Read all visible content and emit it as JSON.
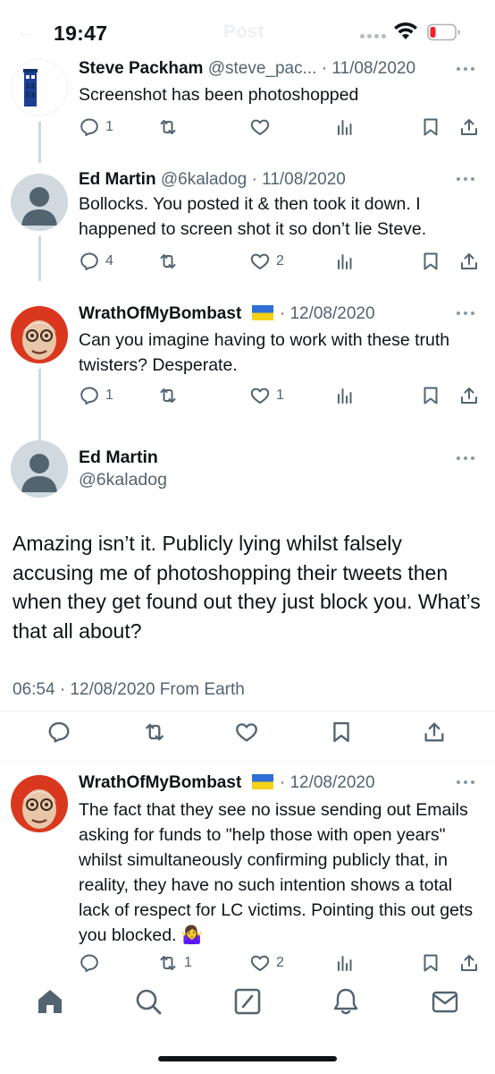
{
  "status_bar": {
    "time": "19:47",
    "ghost_title": "Post"
  },
  "tweets": [
    {
      "name": "Steve Packham",
      "handle": "@steve_pac...",
      "date": "11/08/2020",
      "text": "Screenshot has been photoshopped",
      "reply_count": "1",
      "retweet_count": "",
      "like_count": ""
    },
    {
      "name": "Ed Martin",
      "handle": "@6kaladog",
      "date": "11/08/2020",
      "text": "Bollocks. You posted it & then took it down. I happened to screen shot it so don’t lie Steve.",
      "reply_count": "4",
      "retweet_count": "",
      "like_count": "2"
    },
    {
      "name": "WrathOfMyBombast",
      "handle": "",
      "date": "12/08/2020",
      "text": "Can you imagine having to work with these truth twisters? Desperate.",
      "reply_count": "1",
      "retweet_count": "",
      "like_count": "1"
    }
  ],
  "main_tweet": {
    "name": "Ed Martin",
    "handle": "@6kaladog",
    "text": "Amazing isn’t it. Publicly lying whilst falsely accusing me of photoshopping their tweets then when they get found out they just block you. What’s that all about?",
    "meta": "06:54 · 12/08/2020 From Earth"
  },
  "reply_tweet": {
    "name": "WrathOfMyBombast",
    "date": "12/08/2020",
    "text": "The fact that they see no issue sending out Emails asking for funds to \"help those with open years\" whilst simultaneously confirming publicly that, in reality, they have no such intention shows a total lack of respect for LC victims.  Pointing this out gets you blocked. 🤷‍♀️",
    "reply_count": "",
    "retweet_count": "1",
    "like_count": "2"
  },
  "separator": "·",
  "tabs": [
    "home-icon",
    "search-icon",
    "compose-icon",
    "notifications-icon",
    "messages-icon"
  ],
  "colors": {
    "text": "#0f1419",
    "secondary": "#536471",
    "line": "#cfd9de",
    "divider": "#eff3f4",
    "battery_low": "#f4212e"
  }
}
